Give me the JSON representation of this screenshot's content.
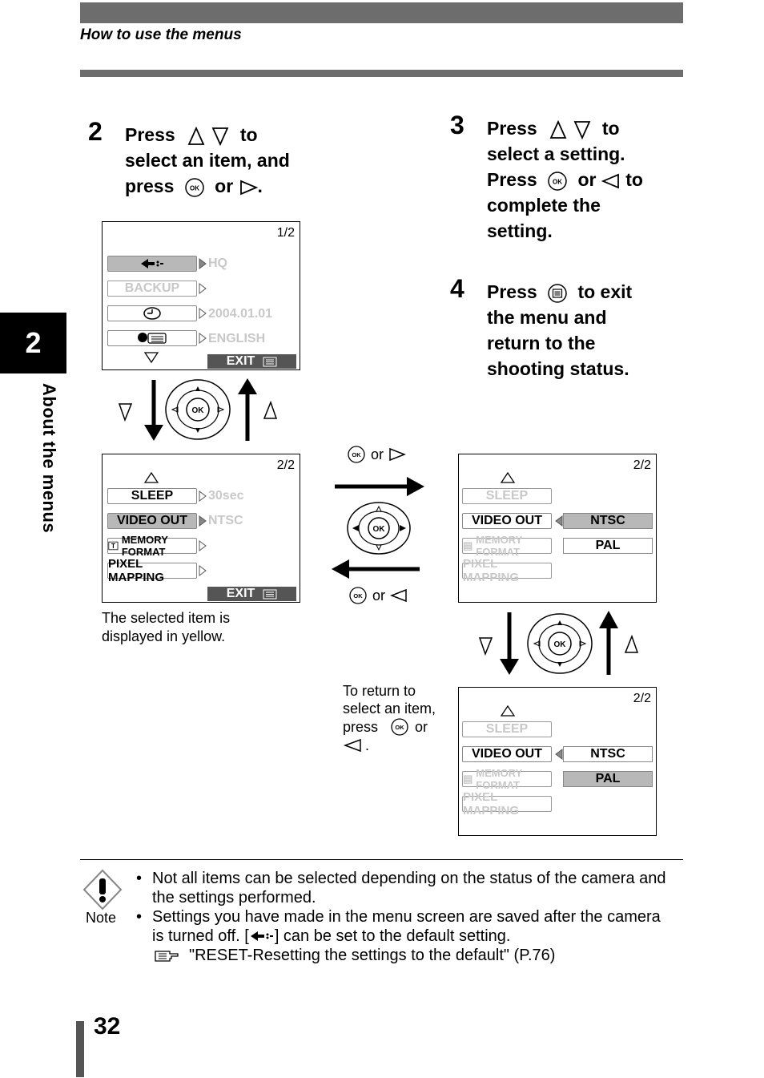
{
  "header": {
    "section_title": "How to use the menus"
  },
  "side_tab": {
    "chapter_number": "2",
    "chapter_title": "About the menus"
  },
  "step2": {
    "number": "2",
    "line1_a": "Press",
    "line1_b": "to",
    "line2": "select an item, and",
    "line3_a": "press",
    "line3_b": "or",
    "line3_c": "."
  },
  "step3": {
    "number": "3",
    "line1_a": "Press",
    "line1_b": "to",
    "line2": "select a setting.",
    "line3_a": "Press",
    "line3_b": "or",
    "line3_c": "to",
    "line4": "complete the",
    "line5": "setting."
  },
  "step4": {
    "number": "4",
    "line1_a": "Press",
    "line1_b": "to exit",
    "line2": "the menu and",
    "line3": "return to the",
    "line4": "shooting status."
  },
  "screen1": {
    "page": "1/2",
    "items": [
      {
        "label": "",
        "icon": "reset-icon",
        "value": "HQ"
      },
      {
        "label": "BACKUP",
        "value": ""
      },
      {
        "label": "",
        "icon": "clock-icon",
        "value": "2004.01.01"
      },
      {
        "label": "",
        "icon": "language-icon",
        "value": "ENGLISH"
      }
    ],
    "exit": "EXIT"
  },
  "screen2": {
    "page": "2/2",
    "items": [
      {
        "label": "SLEEP",
        "value": "30sec"
      },
      {
        "label": "VIDEO OUT",
        "value": "NTSC"
      },
      {
        "label": "MEMORY FORMAT",
        "value": ""
      },
      {
        "label": "PIXEL MAPPING",
        "value": ""
      }
    ],
    "exit": "EXIT"
  },
  "screen3": {
    "page": "2/2",
    "items": [
      "SLEEP",
      "VIDEO OUT",
      "MEMORY FORMAT",
      "PIXEL MAPPING"
    ],
    "options": [
      "NTSC",
      "PAL"
    ]
  },
  "screen4": {
    "page": "2/2",
    "items": [
      "SLEEP",
      "VIDEO OUT",
      "MEMORY FORMAT",
      "PIXEL MAPPING"
    ],
    "options": [
      "NTSC",
      "PAL"
    ]
  },
  "dpad": {
    "center": "OK"
  },
  "flow": {
    "forward_or": "or",
    "back_or": "or"
  },
  "captions": {
    "yellow_line1": "The selected item is",
    "yellow_line2": "displayed in yellow.",
    "return_line1": "To return to",
    "return_line2": "select an item,",
    "return_line3a": "press",
    "return_line3b": "or",
    "return_line4": "."
  },
  "note": {
    "label": "Note",
    "bullet1_line1": "Not all items can be selected depending on the status of the camera and",
    "bullet1_line2": "the settings performed.",
    "bullet2_line1": "Settings you have made in the menu screen are saved after the camera",
    "bullet2_line2a": "is turned off. [",
    "bullet2_line2b": "] can be set to the default setting.",
    "reference": "\"RESET-Resetting the settings to the default\" (P.76)"
  },
  "footer": {
    "page_number": "32"
  }
}
